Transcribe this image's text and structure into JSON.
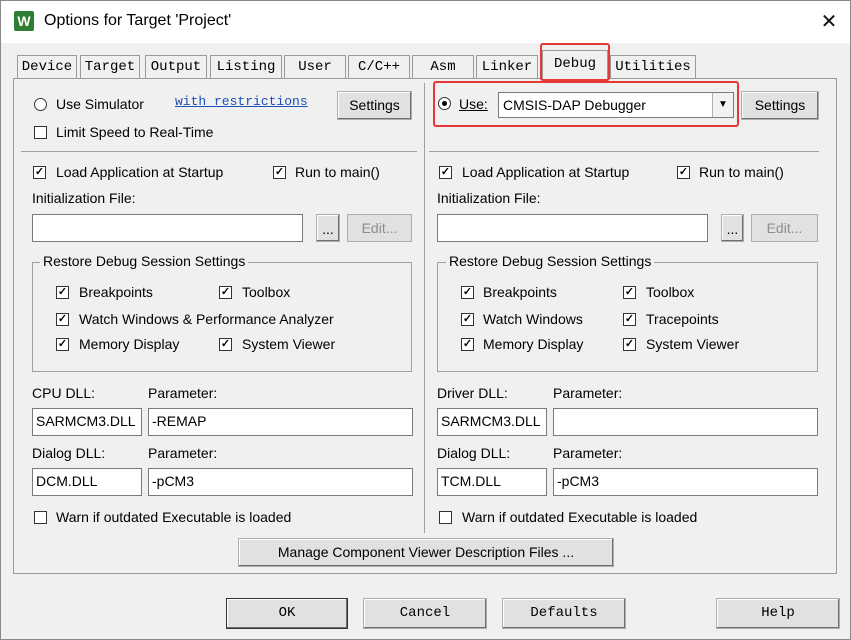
{
  "window": {
    "title": "Options for Target 'Project'",
    "app_icon_glyph": "W",
    "close_glyph": "✕"
  },
  "tabs": [
    {
      "label": "Device"
    },
    {
      "label": "Target"
    },
    {
      "label": "Output"
    },
    {
      "label": "Listing"
    },
    {
      "label": "User"
    },
    {
      "label": "C/C++"
    },
    {
      "label": "Asm"
    },
    {
      "label": "Linker"
    },
    {
      "label": "Debug"
    },
    {
      "label": "Utilities"
    }
  ],
  "active_tab": "Debug",
  "left": {
    "use_simulator_label": "Use Simulator",
    "restrictions_link": "with restrictions",
    "settings_label": "Settings",
    "limit_speed_label": "Limit Speed to Real-Time",
    "load_app_label": "Load Application at Startup",
    "run_to_main_label": "Run to main()",
    "init_file_label": "Initialization File:",
    "init_file_value": "",
    "browse_label": "...",
    "edit_label": "Edit...",
    "restore_group_title": "Restore Debug Session Settings",
    "restore": {
      "breakpoints": "Breakpoints",
      "toolbox": "Toolbox",
      "watch": "Watch Windows & Performance Analyzer",
      "memory": "Memory Display",
      "system_viewer": "System Viewer"
    },
    "cpu_dll_label": "CPU DLL:",
    "cpu_param_label": "Parameter:",
    "cpu_dll_value": "SARMCM3.DLL",
    "cpu_param_value": "-REMAP",
    "dialog_dll_label": "Dialog DLL:",
    "dialog_param_label": "Parameter:",
    "dialog_dll_value": "DCM.DLL",
    "dialog_param_value": "-pCM3",
    "warn_label": "Warn if outdated Executable is loaded"
  },
  "right": {
    "use_label": "Use:",
    "debugger_selected": "CMSIS-DAP Debugger",
    "settings_label": "Settings",
    "load_app_label": "Load Application at Startup",
    "run_to_main_label": "Run to main()",
    "init_file_label": "Initialization File:",
    "init_file_value": "",
    "browse_label": "...",
    "edit_label": "Edit...",
    "restore_group_title": "Restore Debug Session Settings",
    "restore": {
      "breakpoints": "Breakpoints",
      "toolbox": "Toolbox",
      "watch": "Watch Windows",
      "tracepoints": "Tracepoints",
      "memory": "Memory Display",
      "system_viewer": "System Viewer"
    },
    "driver_dll_label": "Driver DLL:",
    "driver_param_label": "Parameter:",
    "driver_dll_value": "SARMCM3.DLL",
    "driver_param_value": "",
    "dialog_dll_label": "Dialog DLL:",
    "dialog_param_label": "Parameter:",
    "dialog_dll_value": "TCM.DLL",
    "dialog_param_value": "-pCM3",
    "warn_label": "Warn if outdated Executable is loaded"
  },
  "manage_button": "Manage Component Viewer Description Files ...",
  "footer": {
    "ok": "OK",
    "cancel": "Cancel",
    "defaults": "Defaults",
    "help": "Help"
  },
  "colors": {
    "highlight": "#e53935",
    "link": "#1e4fb5"
  }
}
